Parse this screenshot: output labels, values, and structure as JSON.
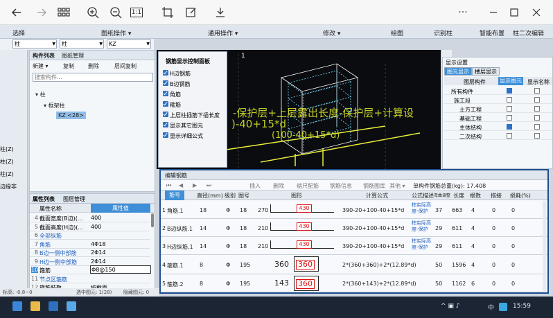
{
  "viewer": {
    "back_icon": "arrow-left-icon",
    "forward_icon": "arrow-right-icon",
    "grid_icon": "grid-icon",
    "zoom_in_icon": "zoom-in-icon",
    "zoom_out_icon": "zoom-out-icon",
    "actual_size_label": "1:1",
    "more_label": "···"
  },
  "menu": {
    "select": "选择",
    "drawing_ops": "图纸操作 ▾",
    "general_ops": "通用操作 ▾",
    "modify": "修改 ▾",
    "draw": "绘图",
    "identify_column": "识别柱",
    "smart_layout": "智能布置",
    "column_edit": "柱二次编辑"
  },
  "dropdowns": {
    "category": "柱",
    "subtype": "柱",
    "name": "KZ"
  },
  "leftmost": {
    "item1": "柱(Z)",
    "item2": "柱(Z)",
    "item3": "柱(Z)",
    "item4": "边缘非"
  },
  "component_panel": {
    "tab_list": "构件列表",
    "tab_drawings": "图纸管理",
    "new": "新建 ▾",
    "copy": "复制",
    "delete": "删除",
    "floor_copy": "层间复制",
    "search_placeholder": "搜索构件...",
    "tree_root": "柱",
    "tree_child": "框架柱",
    "tree_selected": "KZ <28>"
  },
  "property_panel": {
    "tab_props": "属性列表",
    "tab_layers": "图层管理",
    "col_name": "属性名称",
    "col_value": "属性值",
    "rows": [
      {
        "n": "4",
        "name": "截面宽度(B边)(...",
        "value": "400"
      },
      {
        "n": "5",
        "name": "截面高度(H边)(...",
        "value": "400"
      },
      {
        "n": "6",
        "name": "全部纵筋",
        "value": ""
      },
      {
        "n": "7",
        "name": "角筋",
        "value": "4Φ18"
      },
      {
        "n": "8",
        "name": "B边一侧中部筋",
        "value": "2Φ14"
      },
      {
        "n": "9",
        "name": "H边一侧中部筋",
        "value": "2Φ14"
      },
      {
        "n": "10",
        "name": "箍筋",
        "value": "Φ8@150"
      },
      {
        "n": "11",
        "name": "节点区箍筋",
        "value": ""
      },
      {
        "n": "12",
        "name": "箍筋肢数",
        "value": "按截面"
      },
      {
        "n": "13",
        "name": "柱类型",
        "value": "(默认值)"
      },
      {
        "n": "",
        "name": "截面编辑",
        "value": ""
      }
    ]
  },
  "control_panel": {
    "title": "钢筋显示控制面板",
    "items": [
      "H边钢筋",
      "B边钢筋",
      "角筋",
      "箍筋",
      "上层柱插筋下插长度",
      "显示其它图元",
      "显示详细公式"
    ]
  },
  "viewport": {
    "formula_line1": "-保护层+上层露出长度-保护层+计算设",
    "formula_line2": ")-40+15*d",
    "formula_line3": "(100-40+15*d)",
    "corner_label": "1"
  },
  "display_panel": {
    "title": "显示设置",
    "tab_elements": "图元显示",
    "tab_floors": "楼层显示",
    "col_element": "图层构件",
    "col_show": "显示图元",
    "col_name": "显示名称",
    "rows": [
      {
        "label": "所有构件",
        "show": true
      },
      {
        "label": "施工段",
        "show": false
      },
      {
        "label": "土方工程",
        "show": false
      },
      {
        "label": "基础工程",
        "show": false
      },
      {
        "label": "主体结构",
        "show": true
      },
      {
        "label": "二次结构",
        "show": false
      }
    ]
  },
  "rebar_window": {
    "title": "编辑钢筋",
    "tools": [
      "插入",
      "删除",
      "缩尺配筋",
      "钢筋信息",
      "钢筋图库",
      "其他 ▾"
    ],
    "total_weight": "单构件钢筋总重(kg): 17.408",
    "headers": [
      "筋号",
      "直径(mm)",
      "级别",
      "图号",
      "图形",
      "计算公式",
      "公式描述",
      "弯曲调整",
      "长度",
      "根数",
      "搭接",
      "损耗(%)"
    ],
    "rows": [
      {
        "no": "1",
        "name": "角筋.1",
        "dia": "18",
        "grade": "Φ",
        "fig": "18",
        "bend": "270",
        "len_label": "430",
        "formula": "390-20+100-40+15*d",
        "desc": "柱实际高度-保护",
        "adj": "37",
        "length": "663",
        "count": "4",
        "lap": "0",
        "loss": "0"
      },
      {
        "no": "2",
        "name": "B边纵筋.1",
        "dia": "14",
        "grade": "Φ",
        "fig": "18",
        "bend": "210",
        "len_label": "430",
        "formula": "390-20+100-40+15*d",
        "desc": "柱实际高度-保护",
        "adj": "29",
        "length": "611",
        "count": "4",
        "lap": "0",
        "loss": "0"
      },
      {
        "no": "3",
        "name": "H边纵筋.1",
        "dia": "14",
        "grade": "Φ",
        "fig": "18",
        "bend": "210",
        "len_label": "430",
        "formula": "390-20+100-40+15*d",
        "desc": "柱实际高度-保护",
        "adj": "29",
        "length": "611",
        "count": "4",
        "lap": "0",
        "loss": "0"
      },
      {
        "no": "4",
        "name": "箍筋.1",
        "dia": "8",
        "grade": "Φ",
        "fig": "195",
        "bend": "360",
        "len_label": "360",
        "formula": "2*(360+360)+2*(12.89*d)",
        "desc": "",
        "adj": "50",
        "length": "1596",
        "count": "4",
        "lap": "0",
        "loss": "0"
      },
      {
        "no": "5",
        "name": "箍筋.2",
        "dia": "8",
        "grade": "Φ",
        "fig": "195",
        "bend": "143",
        "len_label": "360",
        "formula": "2*(360+143)+2*(12.89*d)",
        "desc": "",
        "adj": "50",
        "length": "1162",
        "count": "6",
        "lap": "0",
        "loss": "0"
      }
    ]
  },
  "status": {
    "elevation": "标高: -0.8~0",
    "selected": "选中图元: 1(28)",
    "hidden": "隐藏图元: 0"
  },
  "taskbar": {
    "ime": "中",
    "time": "15:59"
  }
}
